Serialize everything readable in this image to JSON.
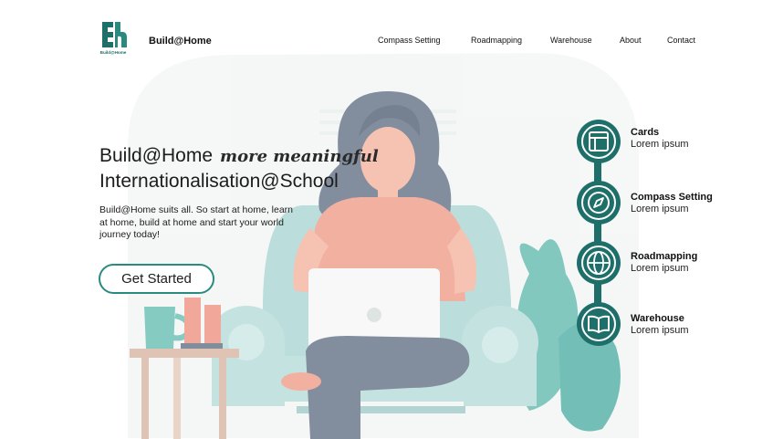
{
  "header": {
    "logo_icon": "buildathome-logo",
    "logo_caption": "Build@Home",
    "brand": "Build@Home",
    "nav": [
      "Compass Setting",
      "Roadmapping",
      "Warehouse",
      "About",
      "Contact"
    ]
  },
  "hero": {
    "headline_line1": "Build@Home",
    "headline_accent": "more meaningful",
    "headline_line2": "Internationalisation@School",
    "blurb": "Build@Home suits all. So start at home, learn at home, build at home and start your world journey today!",
    "cta_label": "Get Started",
    "illustration": "woman-with-laptop-on-armchair-illustration"
  },
  "features": [
    {
      "title": "Cards",
      "subtitle": "Lorem ipsum",
      "icon": "layout-icon"
    },
    {
      "title": "Compass Setting",
      "subtitle": "Lorem ipsum",
      "icon": "compass-icon"
    },
    {
      "title": "Roadmapping",
      "subtitle": "Lorem ipsum",
      "icon": "globe-icon"
    },
    {
      "title": "Warehouse",
      "subtitle": "Lorem ipsum",
      "icon": "book-icon"
    }
  ],
  "colors": {
    "brand_teal": "#1e6f6a",
    "button_border": "#2a8a80",
    "illustration_teal": "#a9d4d2",
    "illustration_coral": "#ef9a86"
  }
}
